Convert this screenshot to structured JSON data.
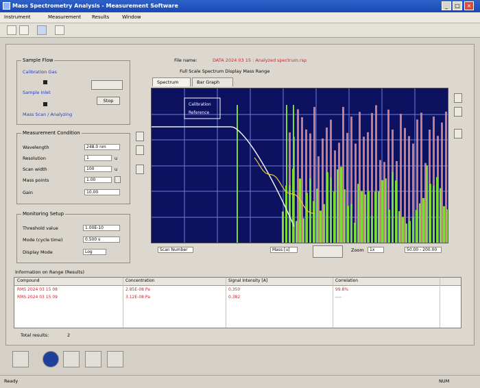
{
  "window": {
    "title": "Mass Spectrometry Analysis - Measurement Software",
    "controls": [
      "_",
      "□",
      "×"
    ]
  },
  "menu": [
    "Instrument",
    "Measurement",
    "Results",
    "Window"
  ],
  "toolbar_icons": [
    "back-icon",
    "forward-icon",
    "instrument-icon",
    "report-icon"
  ],
  "groups": {
    "sample_flow": {
      "title": "Sample Flow",
      "steps": [
        "Calibration Gas",
        "Sample Inlet",
        "Mass Scan / Analyzing"
      ],
      "buttons": [
        "",
        "Stop"
      ]
    },
    "measurement": {
      "title": "Measurement Condition",
      "rows": [
        {
          "label": "Wavelength",
          "value": "248.0 nm",
          "unit": ""
        },
        {
          "label": "Resolution",
          "value": "1",
          "unit": "u"
        },
        {
          "label": "Scan width",
          "value": "100",
          "unit": "u"
        },
        {
          "label": "Mass points",
          "value": "1.00",
          "unit": ""
        },
        {
          "label": "Gain",
          "value": "10.00",
          "unit": ""
        }
      ]
    },
    "monitoring": {
      "title": "Monitoring Setup",
      "rows": [
        {
          "label": "Threshold value",
          "value": "1.00E-10"
        },
        {
          "label": "Mode (cycle time)",
          "value": "0.500 s"
        },
        {
          "label": "Display Mode",
          "value": "Log"
        }
      ]
    }
  },
  "plot": {
    "file_label": "File name:",
    "file_value": "DATA 2024 03 15 : Analyzed spectrum.rsp",
    "info_line": "Full Scale  Spectrum Display  Mass Range",
    "tabs": [
      "Spectrum",
      "Bar Graph"
    ],
    "legend": [
      "Calibration",
      "Reference"
    ],
    "footer": {
      "left": "Scan Number",
      "mid": "Mass [u]",
      "right_label": "Zoom",
      "right_value": "1x",
      "far_right": "50.00 - 200.00"
    }
  },
  "table": {
    "title": "Information on Range (Results)",
    "columns": [
      "Compound",
      "Concentration",
      "Signal Intensity [A]",
      "Correlation"
    ],
    "rows": [
      [
        "RMS 2024 03 15 08",
        "2.85E-08 Pa",
        "0.350",
        "99.8%"
      ],
      [
        "RMS 2024 03 15 09",
        "3.12E-08 Pa",
        "0.382",
        "----"
      ]
    ],
    "footer_label": "Total results:",
    "footer_value": "2"
  },
  "status": {
    "left": "Ready",
    "right": "NUM"
  },
  "colors": {
    "plot_bg": "#0d1260",
    "plot_grid": "#6c7fd8",
    "trace_white": "#f0f0f0",
    "peaks_pink": "#e58f8f",
    "peaks_green": "#7ddb35",
    "accent_red": "#d2202a",
    "accent_blue": "#2b3aa8"
  }
}
